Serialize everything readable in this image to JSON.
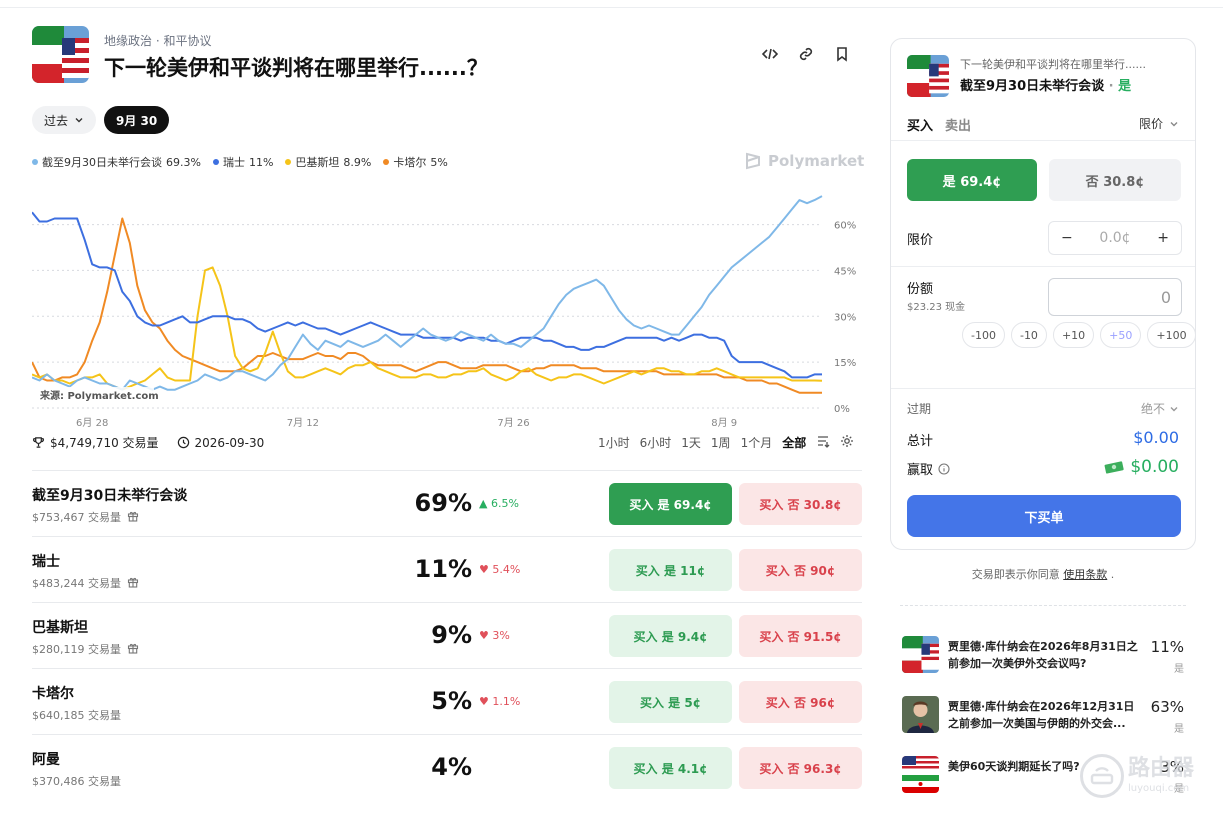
{
  "header": {
    "breadcrumb": "地缘政治 · 和平协议",
    "title": "下一轮美伊和平谈判将在哪里举行......？"
  },
  "filters": {
    "past_label": "过去",
    "date_label": "9月 30"
  },
  "brand": "Polymarket",
  "stats": {
    "volume": "$4,749,710 交易量",
    "end_date": "2026-09-30"
  },
  "ranges": [
    "1小时",
    "6小时",
    "1天",
    "1周",
    "1个月",
    "全部"
  ],
  "active_range": "全部",
  "chart_data": {
    "type": "line",
    "source": "来源: Polymarket.com",
    "x_ticks": [
      "6月 28",
      "7月 12",
      "7月 26",
      "8月 9"
    ],
    "x_tick_index": [
      8,
      36,
      64,
      92
    ],
    "y_ticks": [
      "60%",
      "45%",
      "30%",
      "15%",
      "0%"
    ],
    "ylim": [
      0,
      70
    ],
    "grid": true,
    "legend_position": "top-left",
    "series": [
      {
        "name": "截至9月30日未举行会谈",
        "legend_value": "69.3%",
        "color": "#7fb8e8",
        "values": [
          10,
          9,
          11,
          9,
          8,
          7,
          9,
          10,
          9,
          8,
          8,
          7,
          6,
          9,
          8,
          7,
          6,
          7,
          6,
          6,
          7,
          8,
          9,
          11,
          10,
          9,
          10,
          12,
          12,
          11,
          10,
          9,
          11,
          14,
          16,
          20,
          24,
          21,
          19,
          22,
          21,
          20,
          22,
          21,
          20,
          21,
          22,
          24,
          22,
          20,
          22,
          24,
          26,
          24,
          23,
          22,
          23,
          25,
          24,
          23,
          22,
          24,
          22,
          21,
          21,
          20,
          22,
          24,
          26,
          30,
          34,
          37,
          39,
          40,
          41,
          42,
          40,
          36,
          32,
          29,
          27,
          26,
          27,
          26,
          25,
          24,
          24,
          27,
          30,
          33,
          37,
          40,
          43,
          46,
          48,
          50,
          52,
          54,
          56,
          59,
          62,
          65,
          68,
          67,
          68,
          69.3
        ]
      },
      {
        "name": "瑞士",
        "legend_value": "11%",
        "color": "#3d6fe0",
        "values": [
          64,
          61,
          61,
          62,
          62,
          62,
          62,
          55,
          47,
          46,
          46,
          45,
          38,
          35,
          30,
          28,
          27,
          27,
          28,
          29,
          30,
          28,
          28,
          29,
          30,
          30,
          30,
          29,
          29,
          28,
          26,
          25,
          26,
          27,
          28,
          27,
          28,
          27,
          26,
          26,
          25,
          24,
          25,
          26,
          27,
          28,
          27,
          26,
          25,
          24,
          24,
          24,
          23,
          23,
          23,
          23,
          23,
          22,
          23,
          23,
          23,
          22,
          22,
          21,
          22,
          23,
          23,
          23,
          22,
          22,
          21,
          20,
          20,
          19,
          19,
          20,
          20,
          21,
          22,
          23,
          23,
          23,
          23,
          23,
          22,
          23,
          22,
          23,
          24,
          24,
          23,
          23,
          22,
          17,
          15,
          15,
          15,
          15,
          14,
          13,
          12,
          10,
          10,
          10,
          11,
          11
        ]
      },
      {
        "name": "巴基斯坦",
        "legend_value": "8.9%",
        "color": "#f5c419",
        "values": [
          11,
          10,
          11,
          9,
          9,
          8,
          9,
          10,
          10,
          11,
          8,
          7,
          6,
          7,
          8,
          9,
          11,
          13,
          10,
          9,
          9,
          9,
          30,
          45,
          46,
          40,
          30,
          17,
          13,
          12,
          13,
          18,
          25,
          18,
          12,
          10,
          10,
          11,
          12,
          13,
          12,
          11,
          13,
          14,
          14,
          15,
          13,
          12,
          11,
          10,
          10,
          10,
          11,
          11,
          10,
          10,
          11,
          11,
          12,
          12,
          13,
          11,
          10,
          9,
          10,
          12,
          13,
          11,
          10,
          9,
          10,
          10,
          11,
          11,
          10,
          9,
          8,
          9,
          10,
          11,
          12,
          11,
          12,
          13,
          13,
          12,
          12,
          11,
          11,
          12,
          12,
          13,
          12,
          11,
          10,
          10,
          10,
          10,
          10,
          10,
          10,
          9,
          9,
          9,
          9,
          8.9
        ]
      },
      {
        "name": "卡塔尔",
        "legend_value": "5%",
        "color": "#f08a24",
        "values": [
          15,
          10,
          9,
          9,
          10,
          10,
          11,
          15,
          22,
          28,
          38,
          50,
          62,
          54,
          40,
          32,
          28,
          26,
          22,
          19,
          17,
          16,
          15,
          14,
          13,
          12,
          12,
          12,
          13,
          15,
          17,
          17,
          18,
          17,
          16,
          16,
          16,
          17,
          18,
          17,
          17,
          16,
          18,
          18,
          17,
          15,
          14,
          14,
          14,
          14,
          13,
          12,
          13,
          14,
          15,
          15,
          14,
          13,
          13,
          13,
          14,
          14,
          14,
          14,
          13,
          12,
          12,
          13,
          13,
          14,
          14,
          14,
          14,
          13,
          13,
          13,
          12,
          12,
          12,
          12,
          12,
          12,
          12,
          12,
          11,
          11,
          11,
          11,
          11,
          11,
          11,
          11,
          10,
          10,
          10,
          9,
          9,
          9,
          8,
          8,
          7,
          6,
          5,
          5,
          5,
          5
        ]
      }
    ]
  },
  "outcomes": [
    {
      "name": "截至9月30日未举行会谈",
      "volume": "$753,467 交易量",
      "gift": true,
      "pct": "69%",
      "chg": "▲ 6.5%",
      "dir": "up",
      "yes": "买入 是 69.4¢",
      "no": "买入 否 30.8¢",
      "yes_solid": true
    },
    {
      "name": "瑞士",
      "volume": "$483,244 交易量",
      "gift": true,
      "pct": "11%",
      "chg": "♥ 5.4%",
      "dir": "down",
      "yes": "买入 是 11¢",
      "no": "买入 否 90¢",
      "yes_solid": false
    },
    {
      "name": "巴基斯坦",
      "volume": "$280,119 交易量",
      "gift": true,
      "pct": "9%",
      "chg": "♥ 3%",
      "dir": "down",
      "yes": "买入 是 9.4¢",
      "no": "买入 否 91.5¢",
      "yes_solid": false
    },
    {
      "name": "卡塔尔",
      "volume": "$640,185 交易量",
      "gift": false,
      "pct": "5%",
      "chg": "♥ 1.1%",
      "dir": "down",
      "yes": "买入 是 5¢",
      "no": "买入 否 96¢",
      "yes_solid": false
    },
    {
      "name": "阿曼",
      "volume": "$370,486 交易量",
      "gift": false,
      "pct": "4%",
      "chg": "",
      "dir": "none",
      "yes": "买入 是 4.1¢",
      "no": "买入 否 96.3¢",
      "yes_solid": false
    }
  ],
  "panel": {
    "question": "下一轮美伊和平谈判将在哪里举行......",
    "outcome": "截至9月30日未举行会谈",
    "outcome_side": "是",
    "tab_buy": "买入",
    "tab_sell": "卖出",
    "order_type": "限价",
    "yes_btn": "是 69.4¢",
    "no_btn": "否 30.8¢",
    "limit_label": "限价",
    "limit_value": "0.0¢",
    "shares_label": "份额",
    "cash": "$23.23 现金",
    "amount": "0",
    "quick": [
      "-100",
      "-10",
      "+10",
      "+50",
      "+100"
    ],
    "expiry_label": "过期",
    "expiry_value": "绝不",
    "total_label": "总计",
    "total_value": "$0.00",
    "win_label": "赢取",
    "win_value": "$0.00",
    "order_btn": "下买单"
  },
  "terms": {
    "text": "交易即表示你同意",
    "link": "使用条款",
    "end": "."
  },
  "related": [
    {
      "q": "贾里德·库什纳会在2026年8月31日之前参加一次美伊外交会议吗?",
      "pct": "11%",
      "side": "是"
    },
    {
      "q": "贾里德·库什纳会在2026年12月31日之前参加一次美国与伊朗的外交会...",
      "pct": "63%",
      "side": "是"
    },
    {
      "q": "美伊60天谈判期延长了吗?",
      "pct": "3%",
      "side": "是"
    }
  ],
  "watermark": {
    "main": "路由器",
    "sub": "luyouqi.com"
  }
}
